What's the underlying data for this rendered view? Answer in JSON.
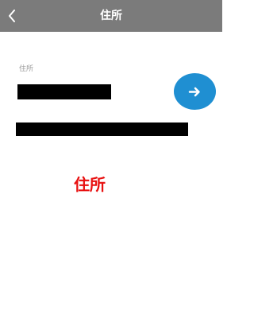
{
  "header": {
    "title": "住所",
    "back_icon": "chevron-left-icon"
  },
  "form": {
    "field_label": "住所",
    "next_button_icon": "arrow-right-icon"
  },
  "annotation": {
    "text": "住所",
    "color": "#e81010"
  },
  "colors": {
    "header_background": "#7b7b7b",
    "button_background": "#1f8fd2",
    "redaction": "#000000"
  }
}
